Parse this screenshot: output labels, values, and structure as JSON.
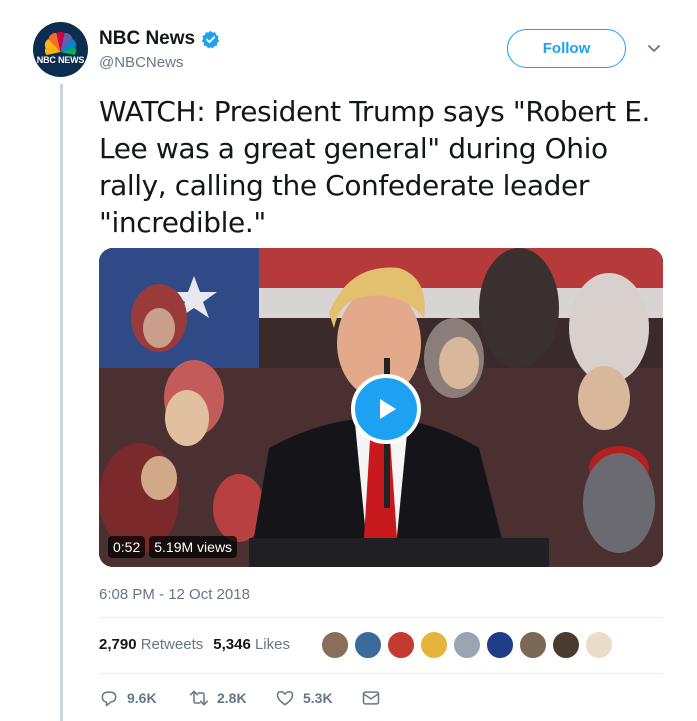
{
  "author": {
    "display_name": "NBC News",
    "handle": "@NBCNews",
    "avatar_text": "NBC NEWS",
    "verified": true
  },
  "follow_label": "Follow",
  "tweet": {
    "text": "WATCH: President Trump says \"Robert E. Lee was a great general\" during Ohio rally, calling the Confederate leader \"incredible.\"",
    "timestamp": "6:08 PM - 12 Oct 2018"
  },
  "video": {
    "duration": "0:52",
    "views": "5.19M views"
  },
  "stats": {
    "retweets_count": "2,790",
    "retweets_label": "Retweets",
    "likes_count": "5,346",
    "likes_label": "Likes",
    "liker_avatar_colors": [
      "#8a6d5a",
      "#3a6b9a",
      "#c23b2e",
      "#e6b43c",
      "#9aa5b1",
      "#1f3c88",
      "#7a6a55",
      "#4a3a30",
      "#e9ddc8"
    ]
  },
  "actions": {
    "replies": "9.6K",
    "retweets": "2.8K",
    "likes": "5.3K"
  },
  "colors": {
    "accent": "#1da1f2",
    "secondary_text": "#657786"
  }
}
